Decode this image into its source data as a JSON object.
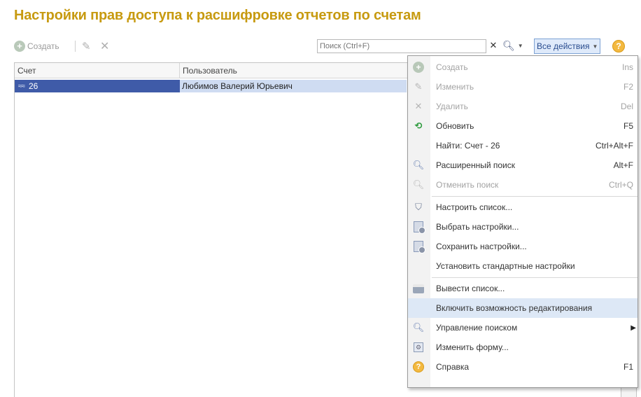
{
  "page": {
    "title": "Настройки прав доступа к расшифровке отчетов по счетам"
  },
  "toolbar": {
    "create_label": "Создать",
    "search_placeholder": "Поиск (Ctrl+F)",
    "all_actions_label": "Все действия",
    "help_label": "?"
  },
  "table": {
    "headers": {
      "account": "Счет",
      "user": "Пользователь"
    },
    "rows": [
      {
        "account": "26",
        "user": "Любимов Валерий Юрьевич"
      }
    ]
  },
  "menu": {
    "items": [
      {
        "label": "Создать",
        "shortcut": "Ins",
        "icon": "plus-circle-icon",
        "disabled": true
      },
      {
        "label": "Изменить",
        "shortcut": "F2",
        "icon": "pencil-icon",
        "disabled": true
      },
      {
        "label": "Удалить",
        "shortcut": "Del",
        "icon": "delete-x-icon",
        "disabled": true
      },
      {
        "label": "Обновить",
        "shortcut": "F5",
        "icon": "refresh-icon",
        "disabled": false
      },
      {
        "label": "Найти: Счет - 26",
        "shortcut": "Ctrl+Alt+F",
        "icon": "",
        "disabled": false
      },
      {
        "label": "Расширенный поиск",
        "shortcut": "Alt+F",
        "icon": "magnifier-icon",
        "disabled": false
      },
      {
        "label": "Отменить поиск",
        "shortcut": "Ctrl+Q",
        "icon": "cancel-search-icon",
        "disabled": true
      },
      {
        "label": "Настроить список...",
        "shortcut": "",
        "icon": "filter-icon",
        "disabled": false
      },
      {
        "label": "Выбрать настройки...",
        "shortcut": "",
        "icon": "load-settings-icon",
        "disabled": false
      },
      {
        "label": "Сохранить настройки...",
        "shortcut": "",
        "icon": "save-settings-icon",
        "disabled": false
      },
      {
        "label": "Установить стандартные настройки",
        "shortcut": "",
        "icon": "",
        "disabled": false
      },
      {
        "label": "Вывести список...",
        "shortcut": "",
        "icon": "print-icon",
        "disabled": false
      },
      {
        "label": "Включить возможность редактирования",
        "shortcut": "",
        "icon": "",
        "disabled": false,
        "highlighted": true
      },
      {
        "label": "Управление поиском",
        "shortcut": "",
        "icon": "search-control-icon",
        "disabled": false,
        "submenu": true
      },
      {
        "label": "Изменить форму...",
        "shortcut": "",
        "icon": "form-icon",
        "disabled": false
      },
      {
        "label": "Справка",
        "shortcut": "F1",
        "icon": "help-icon",
        "disabled": false
      }
    ]
  },
  "colors": {
    "title": "#c79a10",
    "selected_row": "#3f5ba8",
    "selected_row_secondary": "#cfdcf2",
    "menu_highlight": "#dde8f6"
  }
}
